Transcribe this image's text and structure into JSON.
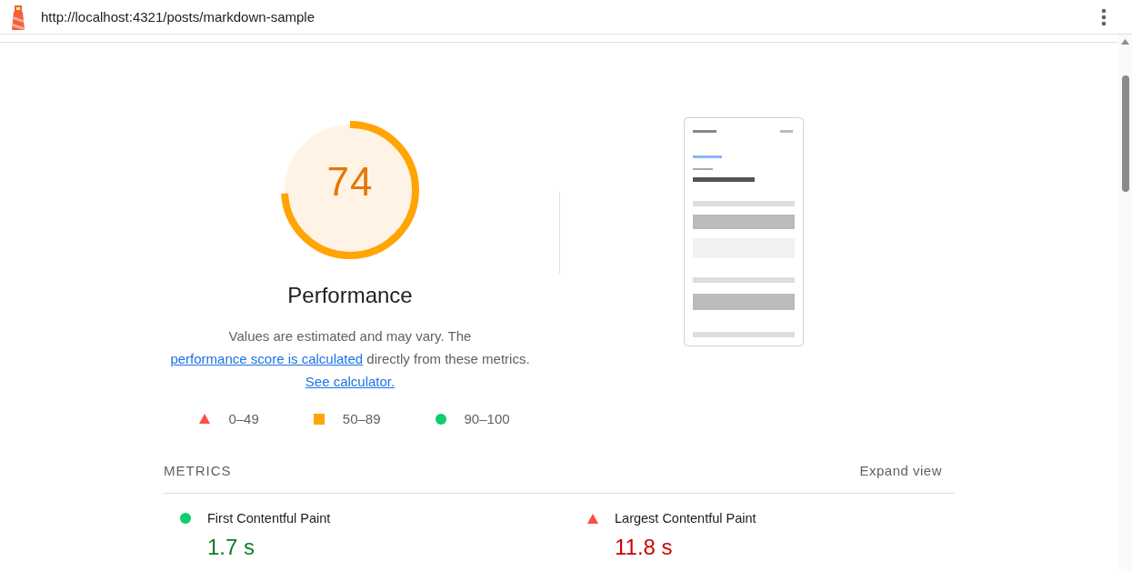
{
  "url": "http://localhost:4321/posts/markdown-sample",
  "gauge": {
    "score": "74",
    "level": 0.74,
    "kind": "average",
    "title": "Performance"
  },
  "description": {
    "text_before": "Values are estimated and may vary. The ",
    "link": "performance score is calculated",
    "text_after": " directly from these metrics.",
    "calculator_link": "See calculator."
  },
  "legend": [
    {
      "kind": "fail",
      "label": "0–49"
    },
    {
      "kind": "average",
      "label": "50–89"
    },
    {
      "kind": "pass",
      "label": "90–100"
    }
  ],
  "metrics_section": {
    "title": "METRICS",
    "toggle": "Expand view"
  },
  "metrics": [
    {
      "name": "First Contentful Paint",
      "value": "1.7 s",
      "kind": "pass"
    },
    {
      "name": "Largest Contentful Paint",
      "value": "11.8 s",
      "kind": "fail"
    }
  ]
}
